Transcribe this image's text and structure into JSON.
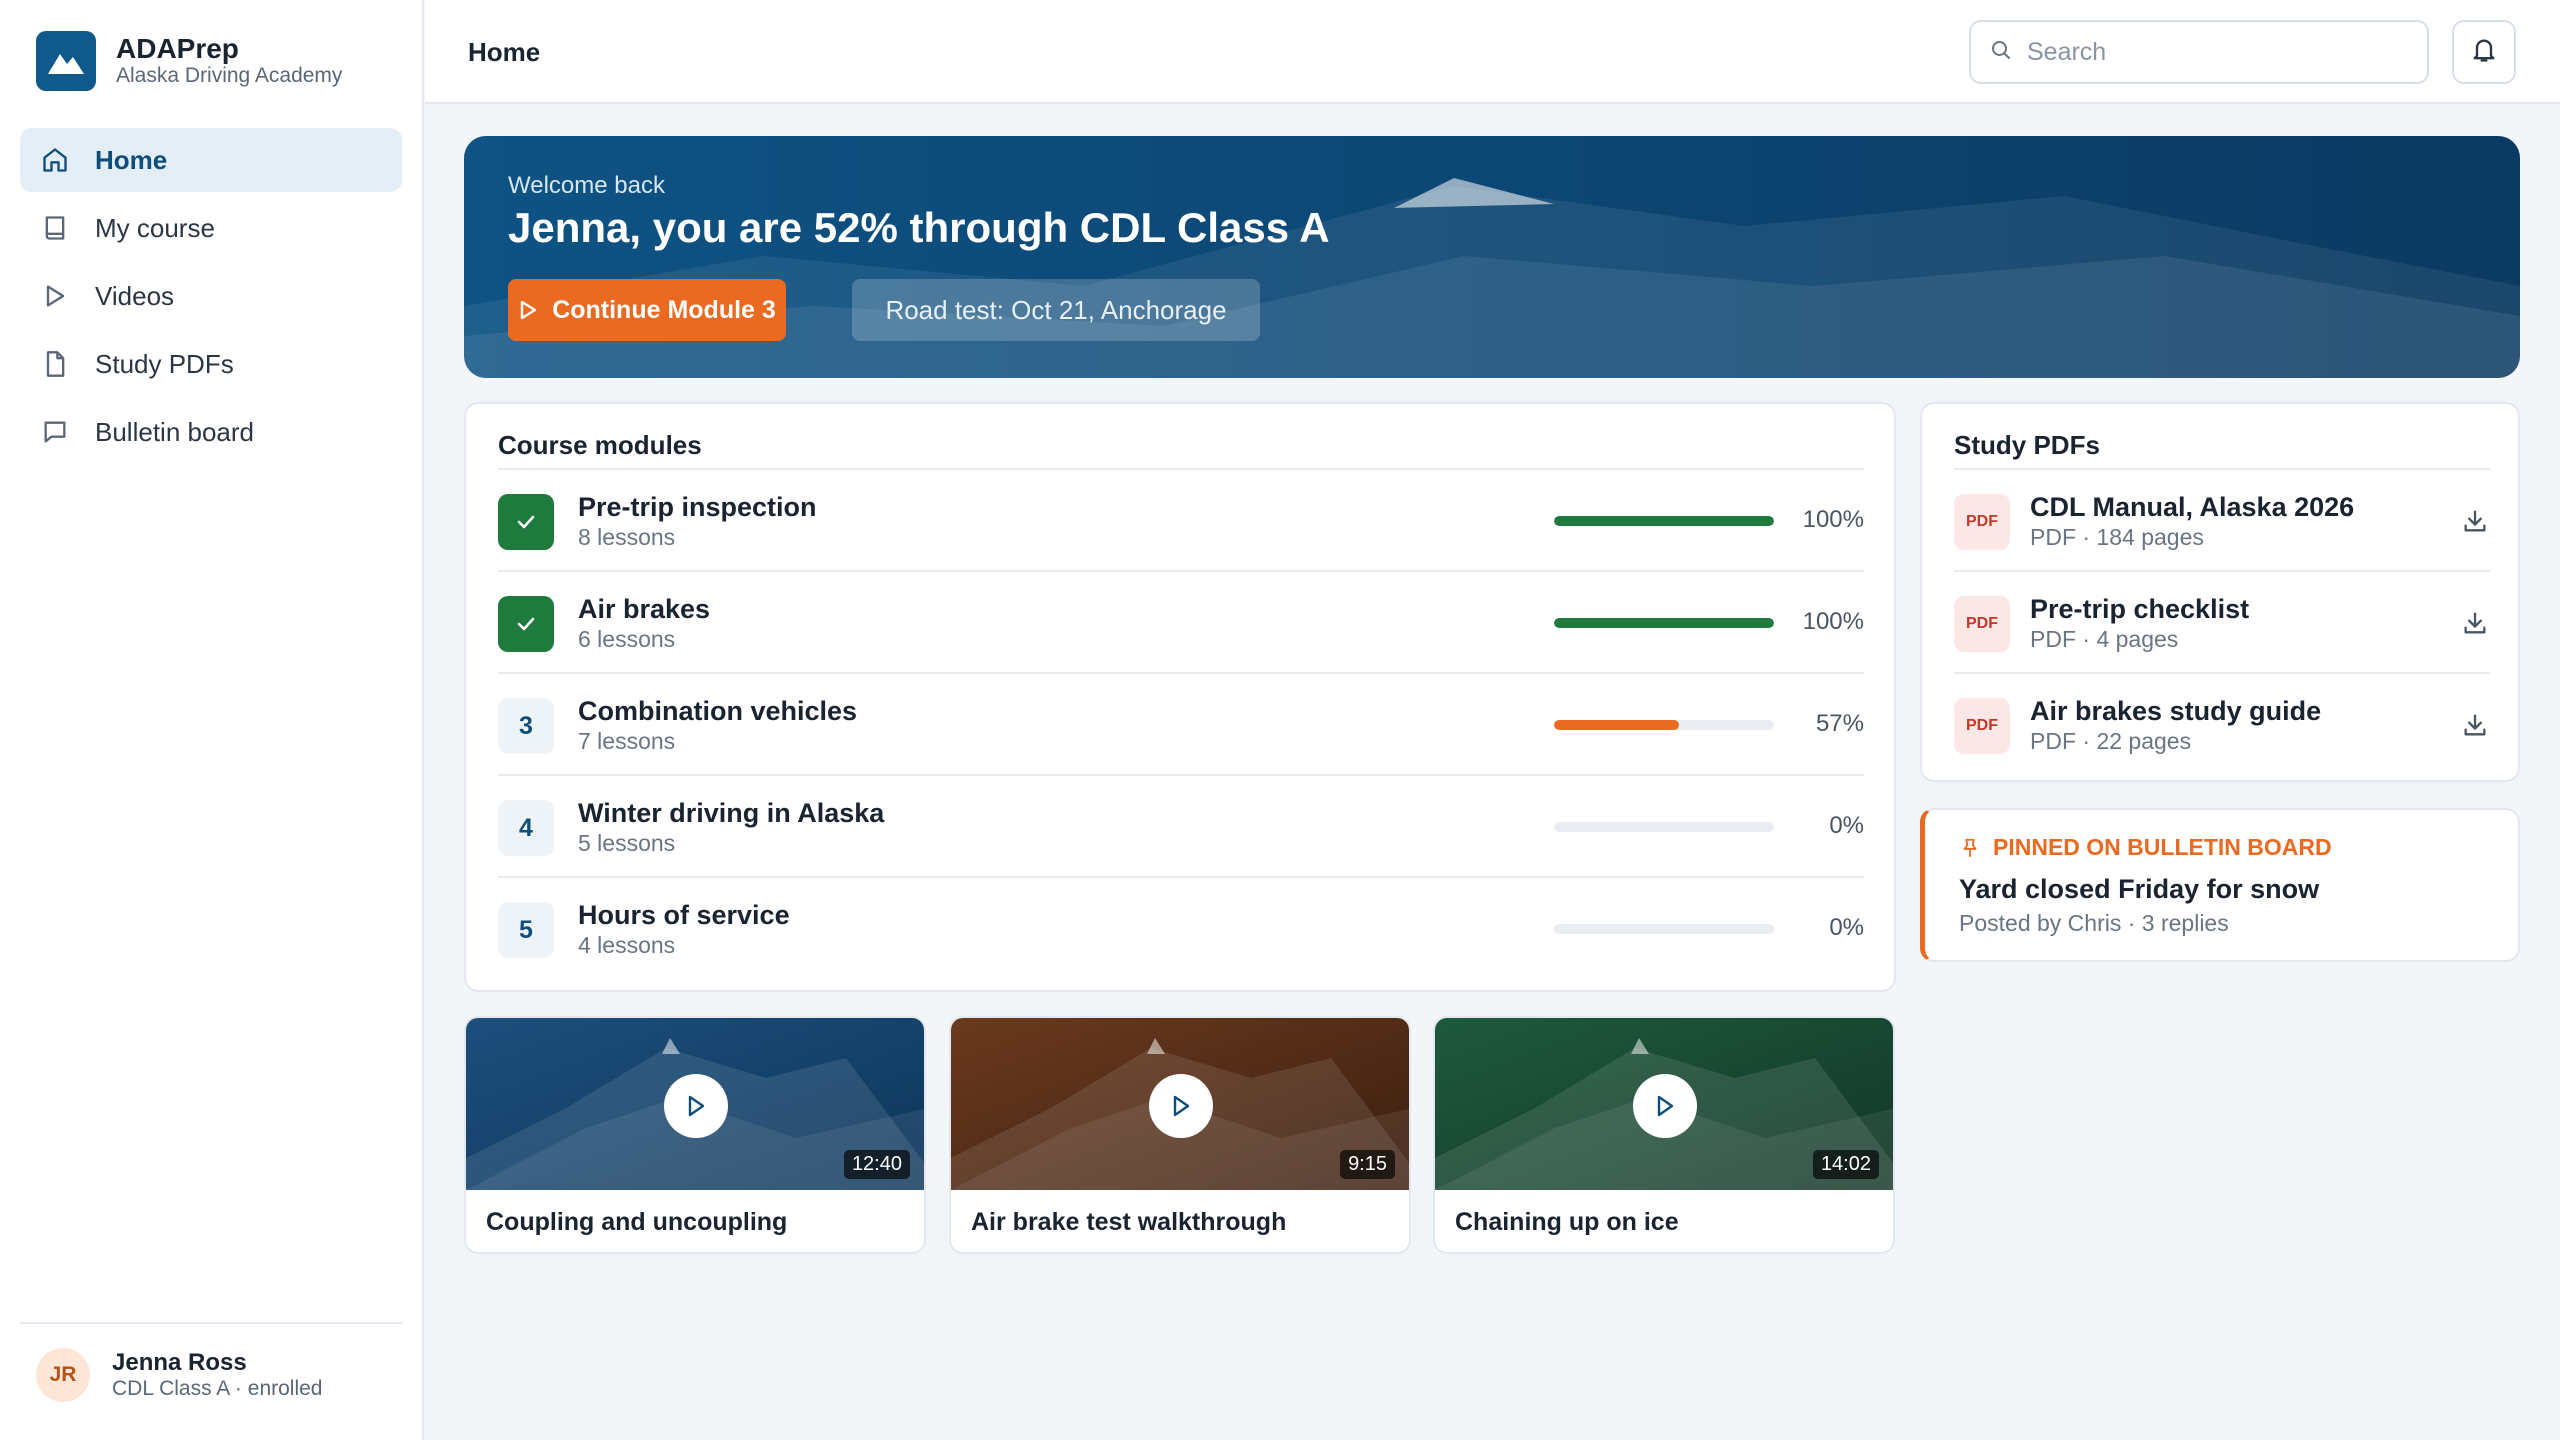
{
  "brand": {
    "name": "ADAPrep",
    "subtitle": "Alaska Driving Academy",
    "logo_icon": "mountain-icon"
  },
  "nav": {
    "items": [
      {
        "label": "Home",
        "icon": "home-icon",
        "active": true
      },
      {
        "label": "My course",
        "icon": "book-icon",
        "active": false
      },
      {
        "label": "Videos",
        "icon": "play-icon",
        "active": false
      },
      {
        "label": "Study PDFs",
        "icon": "file-icon",
        "active": false
      },
      {
        "label": "Bulletin board",
        "icon": "chat-icon",
        "active": false
      }
    ]
  },
  "user": {
    "initials": "JR",
    "name": "Jenna Ross",
    "status": "CDL Class A · enrolled"
  },
  "header": {
    "title": "Home",
    "search_placeholder": "Search",
    "bell_icon": "bell-icon"
  },
  "hero": {
    "welcome": "Welcome back",
    "title": "Jenna, you are 52% through CDL Class A",
    "continue_label": "Continue Module 3",
    "road_test": "Road test: Oct 21, Anchorage"
  },
  "modules": {
    "title": "Course modules",
    "items": [
      {
        "badge": "✓",
        "name": "Pre-trip inspection",
        "lessons": "8 lessons",
        "progress": 100,
        "pct_label": "100%",
        "status": "done"
      },
      {
        "badge": "✓",
        "name": "Air brakes",
        "lessons": "6 lessons",
        "progress": 100,
        "pct_label": "100%",
        "status": "done"
      },
      {
        "badge": "3",
        "name": "Combination vehicles",
        "lessons": "7 lessons",
        "progress": 57,
        "pct_label": "57%",
        "status": "in-progress"
      },
      {
        "badge": "4",
        "name": "Winter driving in Alaska",
        "lessons": "5 lessons",
        "progress": 0,
        "pct_label": "0%",
        "status": "locked"
      },
      {
        "badge": "5",
        "name": "Hours of service",
        "lessons": "4 lessons",
        "progress": 0,
        "pct_label": "0%",
        "status": "locked"
      }
    ]
  },
  "pdfs": {
    "title": "Study PDFs",
    "items": [
      {
        "icon_label": "PDF",
        "name": "CDL Manual, Alaska 2026",
        "meta": "PDF · 184 pages"
      },
      {
        "icon_label": "PDF",
        "name": "Pre-trip checklist",
        "meta": "PDF · 4 pages"
      },
      {
        "icon_label": "PDF",
        "name": "Air brakes study guide",
        "meta": "PDF · 22 pages"
      }
    ]
  },
  "bulletin": {
    "label": "PINNED ON BULLETIN BOARD",
    "title": "Yard closed Friday for snow",
    "meta": "Posted by Chris · 3 replies"
  },
  "videos": [
    {
      "title": "Coupling and uncoupling",
      "duration": "12:40",
      "colors": [
        "#1d4f7d",
        "#0d3559"
      ]
    },
    {
      "title": "Air brake test walkthrough",
      "duration": "9:15",
      "colors": [
        "#6b3a1e",
        "#3a1e10"
      ]
    },
    {
      "title": "Chaining up on ice",
      "duration": "14:02",
      "colors": [
        "#1f5a3d",
        "#123527"
      ]
    }
  ],
  "colors": {
    "accent": "#ea6a22",
    "brand": "#0f5a8a",
    "done": "#1f7a3d",
    "track": "#e9edf1"
  }
}
